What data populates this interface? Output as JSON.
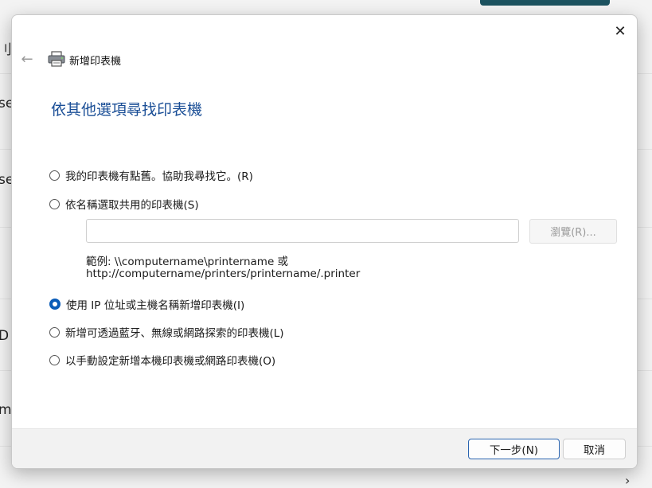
{
  "background": {
    "fragments": [
      "刂出",
      "se",
      "se",
      "D",
      "m"
    ]
  },
  "dialog": {
    "title": "新增印表機",
    "heading": "依其他選項尋找印表機",
    "options": [
      {
        "label": "我的印表機有點舊。協助我尋找它。(R)",
        "checked": false
      },
      {
        "label": "依名稱選取共用的印表機(S)",
        "checked": false
      },
      {
        "label": "使用 IP 位址或主機名稱新增印表機(I)",
        "checked": true
      },
      {
        "label": "新增可透過藍牙、無線或網路探索的印表機(L)",
        "checked": false
      },
      {
        "label": "以手動設定新增本機印表機或網路印表機(O)",
        "checked": false
      }
    ],
    "share_name_value": "",
    "browse_label": "瀏覽(R)...",
    "example_line1": "範例: \\\\computername\\printername 或",
    "example_line2": "http://computername/printers/printername/.printer",
    "next_label": "下一步(N)",
    "cancel_label": "取消"
  },
  "icons": {
    "close": "close-icon",
    "back": "back-arrow-icon",
    "printer": "printer-icon",
    "chevron": "chevron-right-icon"
  },
  "colors": {
    "heading": "#1a4e96",
    "accent": "#0a5cb8",
    "bg_button": "#1d5360"
  }
}
